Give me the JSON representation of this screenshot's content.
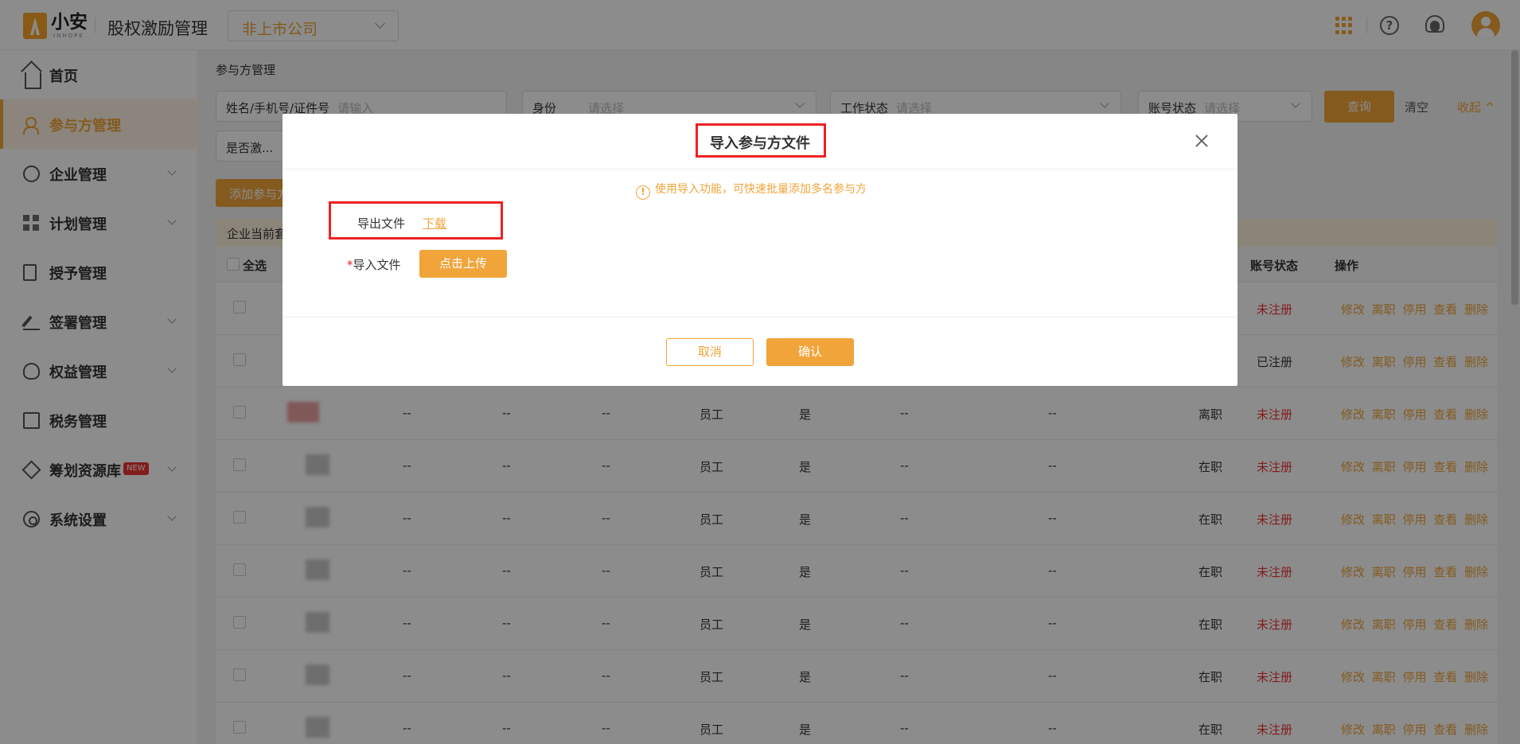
{
  "header": {
    "logo_text": "小安",
    "logo_sub": "INHOPE",
    "app_title": "股权激励管理",
    "company_select": "非上市公司"
  },
  "sidebar": {
    "items": [
      {
        "label": "首页",
        "icon": "home-icon"
      },
      {
        "label": "参与方管理",
        "icon": "users-icon"
      },
      {
        "label": "企业管理",
        "icon": "company-icon"
      },
      {
        "label": "计划管理",
        "icon": "grid-icon"
      },
      {
        "label": "授予管理",
        "icon": "document-icon"
      },
      {
        "label": "签署管理",
        "icon": "pen-icon"
      },
      {
        "label": "权益管理",
        "icon": "badge-icon"
      },
      {
        "label": "税务管理",
        "icon": "tax-icon"
      },
      {
        "label": "筹划资源库",
        "icon": "layers-icon",
        "badge": "NEW"
      },
      {
        "label": "系统设置",
        "icon": "gear-icon"
      }
    ]
  },
  "page": {
    "breadcrumb": "参与方管理",
    "filters": {
      "name": {
        "label": "姓名/手机号/证件号",
        "placeholder": "请输入"
      },
      "identity": {
        "label": "身份",
        "placeholder": "请选择"
      },
      "work_status": {
        "label": "工作状态",
        "placeholder": "请选择"
      },
      "account_status": {
        "label": "账号状态",
        "placeholder": "请选择"
      },
      "activated": {
        "label": "是否激..."
      }
    },
    "query_button": "查询",
    "clear_button": "清空",
    "collapse_button": "收起 ^",
    "add_button": "添加参与方",
    "tip_bar": "企业当前套"
  },
  "table": {
    "headers": {
      "select_all": "全选",
      "account_status": "账号状态",
      "actions": "操作"
    },
    "rows": [
      {
        "c1": "",
        "c2": "",
        "c3": "",
        "role": "",
        "active": "",
        "c4": "",
        "c5": "",
        "work": "",
        "account": "未注册"
      },
      {
        "c1": "",
        "c2": "",
        "c3": "",
        "role": "",
        "active": "",
        "c4": "",
        "c5": "",
        "work": "",
        "account": "已注册"
      },
      {
        "c1": "--",
        "c2": "--",
        "c3": "--",
        "role": "员工",
        "active": "是",
        "c4": "--",
        "c5": "--",
        "work": "离职",
        "account": "未注册"
      },
      {
        "c1": "--",
        "c2": "--",
        "c3": "--",
        "role": "员工",
        "active": "是",
        "c4": "--",
        "c5": "--",
        "work": "在职",
        "account": "未注册"
      },
      {
        "c1": "--",
        "c2": "--",
        "c3": "--",
        "role": "员工",
        "active": "是",
        "c4": "--",
        "c5": "--",
        "work": "在职",
        "account": "未注册"
      },
      {
        "c1": "--",
        "c2": "--",
        "c3": "--",
        "role": "员工",
        "active": "是",
        "c4": "--",
        "c5": "--",
        "work": "在职",
        "account": "未注册"
      },
      {
        "c1": "--",
        "c2": "--",
        "c3": "--",
        "role": "员工",
        "active": "是",
        "c4": "--",
        "c5": "--",
        "work": "在职",
        "account": "未注册"
      },
      {
        "c1": "--",
        "c2": "--",
        "c3": "--",
        "role": "员工",
        "active": "是",
        "c4": "--",
        "c5": "--",
        "work": "在职",
        "account": "未注册"
      },
      {
        "c1": "--",
        "c2": "--",
        "c3": "--",
        "role": "员工",
        "active": "是",
        "c4": "--",
        "c5": "--",
        "work": "在职",
        "account": "未注册"
      }
    ],
    "actions": "修改 离职 停用 查看 删除"
  },
  "modal": {
    "title": "导入参与方文件",
    "tip": "使用导入功能，可快速批量添加多名参与方",
    "export_label": "导出文件",
    "export_link": "下载",
    "import_required": "*",
    "import_label": "导入文件",
    "upload_button": "点击上传",
    "cancel_button": "取消",
    "ok_button": "确认"
  },
  "colors": {
    "accent": "#f0a43a",
    "danger": "#e33",
    "highlight_box": "#e22"
  }
}
